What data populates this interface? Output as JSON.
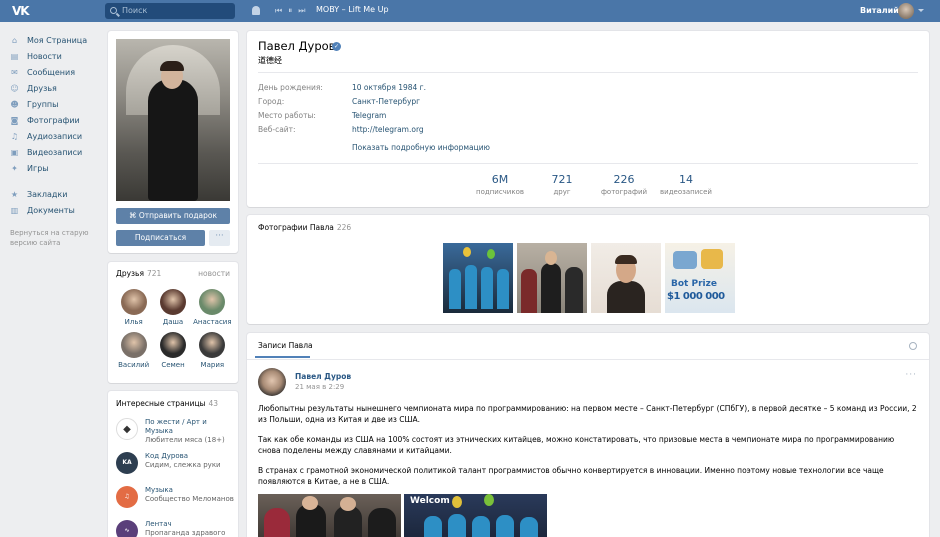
{
  "header": {
    "logo": "VK",
    "search_placeholder": "Поиск",
    "player": {
      "prev": "⏮",
      "pause": "⏸",
      "next": "⏭"
    },
    "track": "MOBY – Lift Me Up",
    "user_name": "Виталий",
    "colors": {
      "bar": "#4a76a8"
    }
  },
  "nav": {
    "items": [
      {
        "label": "Моя Страница",
        "icon": "home-icon",
        "glyph": "⌂"
      },
      {
        "label": "Новости",
        "icon": "news-icon",
        "glyph": "▤"
      },
      {
        "label": "Сообщения",
        "icon": "messages-icon",
        "glyph": "✉"
      },
      {
        "label": "Друзья",
        "icon": "friends-icon",
        "glyph": "☺"
      },
      {
        "label": "Группы",
        "icon": "groups-icon",
        "glyph": "☻"
      },
      {
        "label": "Фотографии",
        "icon": "photos-icon",
        "glyph": "◙"
      },
      {
        "label": "Аудиозаписи",
        "icon": "audio-icon",
        "glyph": "♫"
      },
      {
        "label": "Видеозаписи",
        "icon": "video-icon",
        "glyph": "▣"
      },
      {
        "label": "Игры",
        "icon": "games-icon",
        "glyph": "✦"
      }
    ],
    "items2": [
      {
        "label": "Закладки",
        "icon": "bookmarks-icon",
        "glyph": "★"
      },
      {
        "label": "Документы",
        "icon": "documents-icon",
        "glyph": "▥"
      }
    ],
    "note": "Вернуться на старую версию сайта"
  },
  "profile": {
    "gift_button": "Отправить подарок",
    "subscribe_button": "Подписаться",
    "more_button": "···",
    "name": "Павел Дуров",
    "status": "道德经",
    "info": [
      {
        "label": "День рождения:",
        "value": "10 октября 1984 г."
      },
      {
        "label": "Город:",
        "value": "Санкт-Петербург"
      },
      {
        "label": "Место работы:",
        "value": "Telegram"
      },
      {
        "label": "Веб-сайт:",
        "value": "http://telegram.org"
      }
    ],
    "show_more": "Показать подробную информацию",
    "counters": [
      {
        "n": "6M",
        "label": "подписчиков"
      },
      {
        "n": "721",
        "label": "друг"
      },
      {
        "n": "226",
        "label": "фотографий"
      },
      {
        "n": "14",
        "label": "видеозаписей"
      }
    ]
  },
  "friends": {
    "title": "Друзья",
    "count": "721",
    "more": "новости",
    "list": [
      {
        "name": "Илья",
        "color": "#8a6a55"
      },
      {
        "name": "Даша",
        "color": "#5a3a30"
      },
      {
        "name": "Анастасия",
        "color": "#6a8a6a"
      },
      {
        "name": "Василий",
        "color": "#7a7068"
      },
      {
        "name": "Семен",
        "color": "#2a2a2a"
      },
      {
        "name": "Мария",
        "color": "#3a3a3a"
      }
    ]
  },
  "pages": {
    "title": "Интересные страницы",
    "count": "43",
    "list": [
      {
        "title": "По жести / Арт и Музыка",
        "sub": "Любители мяса (18+)",
        "color": "#ffffff",
        "mark": "◆"
      },
      {
        "title": "Код Дурова",
        "sub": "Сидим, слежка руки",
        "color": "#2d3e50",
        "mark": "KA"
      },
      {
        "title": "Музыка",
        "sub": "Сообщество Меломанов",
        "color": "#e36c44",
        "mark": "♫"
      },
      {
        "title": "Лентач",
        "sub": "Пропаганда здравого",
        "color": "#5a3f7a",
        "mark": "∿"
      }
    ]
  },
  "photos": {
    "title": "Фотографии Павла",
    "count": "226",
    "prize_text": "Bot Prize",
    "prize_amount": "$1 000 000"
  },
  "wall": {
    "tab": "Записи Павла",
    "post": {
      "author": "Павел Дуров",
      "date": "21 мая в 2:29",
      "dots": "···",
      "paragraphs": [
        "Любопытны результаты нынешнего чемпионата мира по программированию: на первом месте – Санкт-Петербург (СПбГУ), в первой десятке – 5 команд из России, 2 из Польши, одна из Китая и две из США.",
        "Так как обе команды из США на 100% состоят из этнических китайцев, можно констатировать, что призовые места в чемпионате мира по программированию снова поделены между славянами и китайцами.",
        "В странах с грамотной экономической политикой талант программистов обычно конвертируется в инновации. Именно поэтому новые технологии все чаще появляются в Китае, а не в США."
      ],
      "image_caption": "Welcom"
    }
  }
}
